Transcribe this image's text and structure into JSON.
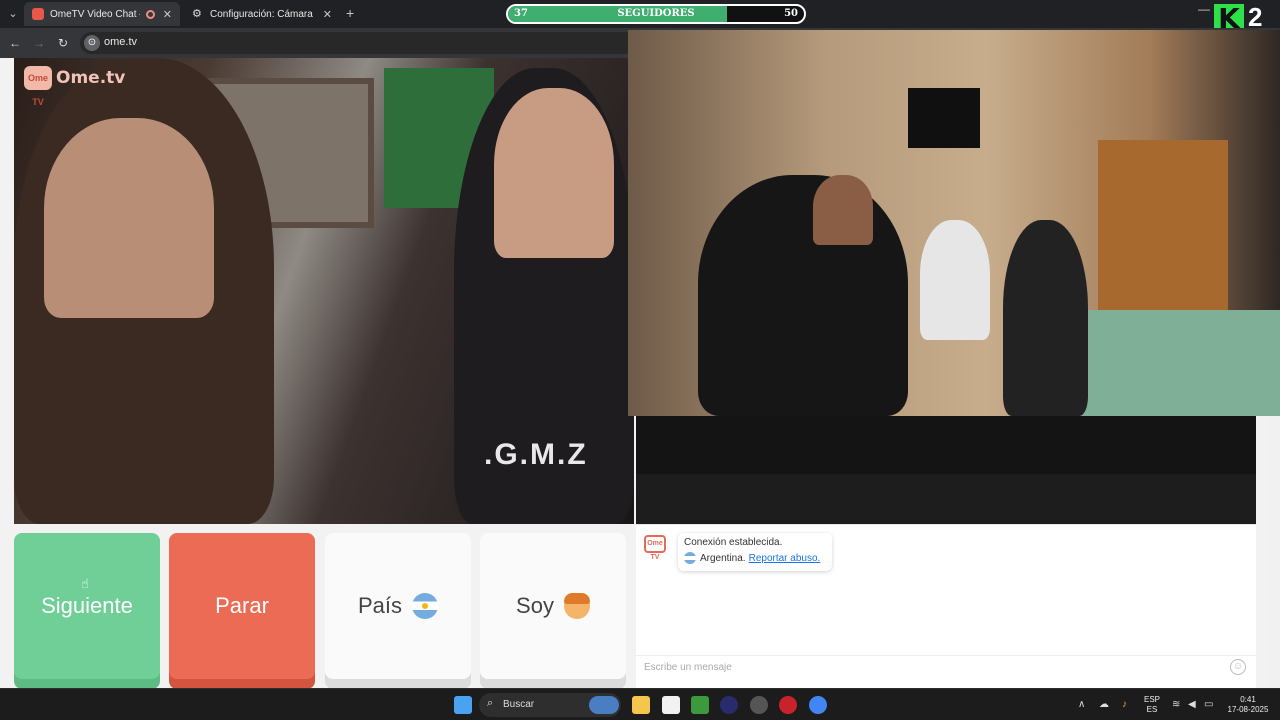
{
  "browser": {
    "tabs": [
      {
        "label": "OmeTV Video Chat — Ome",
        "active": true
      },
      {
        "label": "Configuración: Cámara",
        "active": false
      }
    ],
    "url": "ome.tv"
  },
  "overlay": {
    "followers_label": "SEGUIDORES",
    "followers_current": "37",
    "followers_goal": "50",
    "progress": 0.74
  },
  "site": {
    "brand": "Ome.tv",
    "brand_icon_text": "Ome TV",
    "shirt_text": ".G.M.Z"
  },
  "buttons": {
    "next": "Siguiente",
    "stop": "Parar",
    "country": "País",
    "gender": "Soy"
  },
  "chat": {
    "status": "Conexión establecida.",
    "country": "Argentina.",
    "report": "Reportar abuso.",
    "placeholder": "Escribe un mensaje"
  },
  "taskbar": {
    "search": "Buscar",
    "lang_top": "ESP",
    "lang_bottom": "ES",
    "time": "0:41",
    "date": "17-08-2025"
  },
  "colors": {
    "next": "#6fcf97",
    "stop": "#eb6b55",
    "link": "#1a73e8",
    "follow_fill": "#3fae6f"
  }
}
